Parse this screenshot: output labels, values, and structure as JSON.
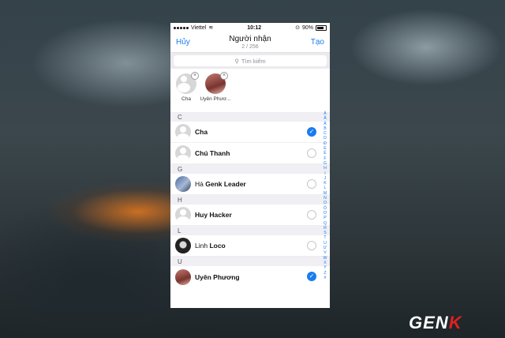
{
  "status": {
    "carrier": "Viettel",
    "time": "10:12",
    "battery": "90%"
  },
  "nav": {
    "cancel": "Hủy",
    "title": "Người nhận",
    "subtitle": "2 / 256",
    "create": "Tạo"
  },
  "search": {
    "placeholder": "Tìm kiếm"
  },
  "selected": [
    {
      "name": "Cha"
    },
    {
      "name": "Uyên Phươ..."
    }
  ],
  "sections": [
    {
      "letter": "C",
      "contacts": [
        {
          "first": "",
          "bold": "Cha",
          "checked": true
        },
        {
          "first": "",
          "bold": "Chú Thanh",
          "checked": false
        }
      ]
    },
    {
      "letter": "G",
      "contacts": [
        {
          "first": "Hà ",
          "bold": "Genk Leader",
          "checked": false
        }
      ]
    },
    {
      "letter": "H",
      "contacts": [
        {
          "first": "",
          "bold": "Huy Hacker",
          "checked": false
        }
      ]
    },
    {
      "letter": "L",
      "contacts": [
        {
          "first": "Linh ",
          "bold": "Loco",
          "checked": false
        }
      ]
    },
    {
      "letter": "U",
      "contacts": [
        {
          "first": "",
          "bold": "Uyên Phương",
          "checked": true
        }
      ]
    }
  ],
  "index": [
    "Á",
    "Ă",
    "Â",
    "B",
    "C",
    "D",
    "Đ",
    "E",
    "Ê",
    "F",
    "G",
    "H",
    "I",
    "J",
    "K",
    "L",
    "M",
    "N",
    "O",
    "Ô",
    "Ơ",
    "P",
    "Q",
    "R",
    "S",
    "T",
    "U",
    "Ư",
    "V",
    "W",
    "X",
    "Y",
    "Z",
    "#"
  ],
  "watermark": {
    "main": "GEN",
    "accent": "K"
  }
}
